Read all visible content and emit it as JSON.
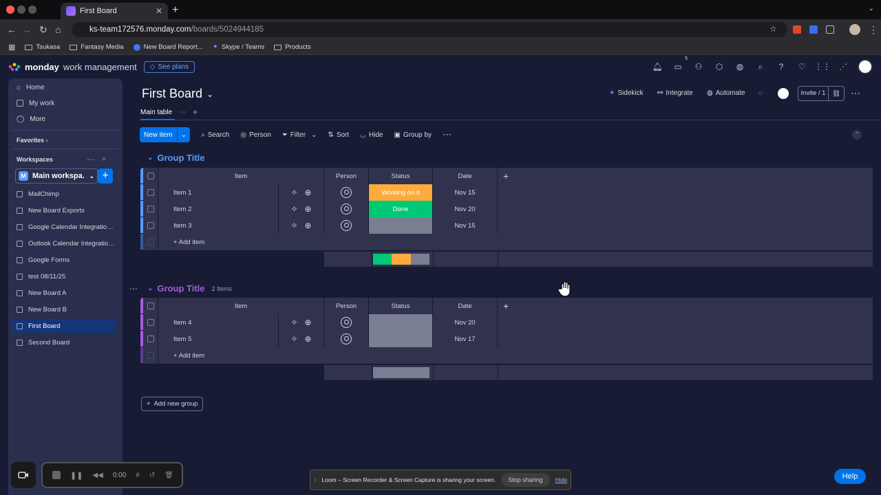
{
  "browser": {
    "tab_title": "First Board",
    "url_host": "ks-team172576.monday.com",
    "url_path": "/boards/5024944185",
    "bookmarks": [
      "Tsukasa",
      "Fantasy Media",
      "New Board Report...",
      "Skype / Teams",
      "Products"
    ]
  },
  "topbar": {
    "brand": "monday",
    "product": "work management",
    "see_plans": "See plans",
    "notification_badge": "5"
  },
  "sidebar": {
    "nav": [
      "Home",
      "My work",
      "More"
    ],
    "favorites": "Favorites",
    "workspaces": "Workspaces",
    "workspace_name": "Main workspa...",
    "workspace_initial": "M",
    "boards": [
      "MailChimp",
      "New Board Exports",
      "Google Calendar Integration ...",
      "Outlook Calendar Integration...",
      "Google Forms",
      "test 08/11/25",
      "New Board A",
      "New Board B",
      "First Board",
      "Second Board"
    ]
  },
  "board": {
    "title": "First Board",
    "tab": "Main table",
    "actions": {
      "sidekick": "Sidekick",
      "integrate": "Integrate",
      "automate": "Automate",
      "invite": "Invite / 1"
    },
    "toolbar": {
      "new_item": "New item",
      "search": "Search",
      "person": "Person",
      "filter": "Filter",
      "sort": "Sort",
      "hide": "Hide",
      "group_by": "Group by"
    },
    "columns": {
      "item": "Item",
      "person": "Person",
      "status": "Status",
      "date": "Date"
    },
    "groups": [
      {
        "title": "Group Title",
        "count": "",
        "color": "#579bfc",
        "add_item": "+ Add item",
        "items": [
          {
            "name": "Item 1",
            "status": "Working on it",
            "status_color": "#fdab3d",
            "date": "Nov 15"
          },
          {
            "name": "Item 2",
            "status": "Done",
            "status_color": "#00c875",
            "date": "Nov 20"
          },
          {
            "name": "Item 3",
            "status": "",
            "status_color": "#797e93",
            "date": "Nov 15"
          }
        ],
        "status_summary": [
          {
            "color": "#00c875",
            "fraction": 0.333
          },
          {
            "color": "#fdab3d",
            "fraction": 0.333
          },
          {
            "color": "#797e93",
            "fraction": 0.334
          }
        ]
      },
      {
        "title": "Group Title",
        "count": "2 Items",
        "color": "#a25ddc",
        "add_item": "+ Add item",
        "items": [
          {
            "name": "Item 4",
            "status": "",
            "status_color": "#797e93",
            "date": "Nov 20"
          },
          {
            "name": "Item 5",
            "status": "",
            "status_color": "#797e93",
            "date": "Nov 17"
          }
        ],
        "status_summary": [
          {
            "color": "#797e93",
            "fraction": 1.0
          }
        ]
      }
    ],
    "add_group": "Add new group"
  },
  "loom": {
    "timer": "0:00",
    "share_text": "Loom – Screen Recorder & Screen Capture is sharing your screen.",
    "stop_sharing": "Stop sharing",
    "hide": "Hide"
  },
  "help": "Help"
}
